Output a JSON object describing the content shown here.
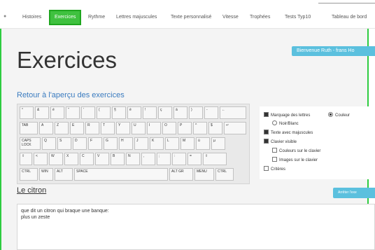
{
  "nav": {
    "items": [
      "Histoires",
      "Exercices",
      "Rythme",
      "Lettres majuscules",
      "Texte personnalisé",
      "Vitesse",
      "Trophées",
      "Tests Typ10",
      "Tableau de bord"
    ]
  },
  "page": {
    "title": "Exercices"
  },
  "welcome": {
    "label": "Bienvenue Ruth - frans Ho"
  },
  "back_link": "Retour à l'aperçu des exercices",
  "keyboard": {
    "rows": [
      [
        "°",
        "&",
        "é",
        "\"",
        "'",
        "(",
        "§",
        "è",
        "!",
        "ç",
        "à",
        ")",
        "-",
        "←"
      ],
      [
        "TAB",
        "A",
        "Z",
        "E",
        "R",
        "T",
        "Y",
        "U",
        "I",
        "O",
        "P",
        "^",
        "$",
        "↵"
      ],
      [
        "CAPS LOCK",
        "Q",
        "S",
        "D",
        "F",
        "G",
        "H",
        "J",
        "K",
        "L",
        "M",
        "ù",
        "µ"
      ],
      [
        "⇧",
        "<",
        "W",
        "X",
        "C",
        "V",
        "B",
        "N",
        ",",
        ";",
        ":",
        "=",
        "⇧"
      ],
      [
        "CTRL",
        "WIN",
        "ALT",
        "SPACE",
        "ALT GR",
        "MENU",
        "CTRL"
      ]
    ]
  },
  "options": {
    "marquage": "Marquage des lettres",
    "couleur": "Couleur",
    "noir_blanc": "Noir/Blanc",
    "majuscules": "Texte avec majuscules",
    "clavier_visible": "Clavier visible",
    "couleurs_clavier": "Couleurs sur le clavier",
    "images_clavier": "Images sur le clavier",
    "criteres": "Critères"
  },
  "exercise": {
    "title": "Le citron",
    "stop_label": "Arrêter l'exe",
    "lines": [
      "que dit un citron qui braque une banque:",
      "plus un zeste"
    ]
  }
}
